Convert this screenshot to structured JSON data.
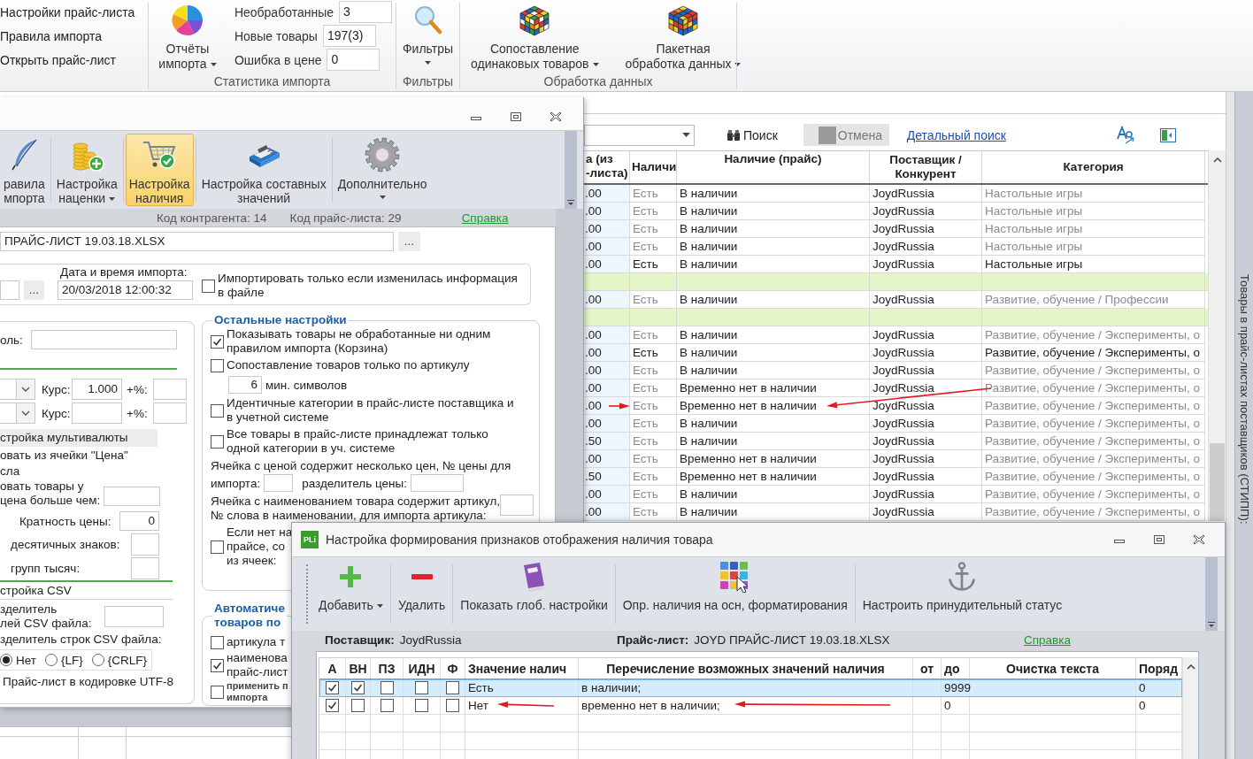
{
  "ribbon": {
    "links": [
      "Настройки прайс-листа",
      "Правила импорта",
      "Открыть прайс-лист"
    ],
    "statistics": {
      "title": "Статистика импорта",
      "reports_button": {
        "lines": [
          "Отчёты",
          "импорта"
        ],
        "dropdown": true
      },
      "counters": [
        {
          "label": "Необработанные",
          "value": "3"
        },
        {
          "label": "Новые товары",
          "value": "197(3)"
        },
        {
          "label": "Ошибка в цене",
          "value": "0"
        }
      ]
    },
    "filters": {
      "title": "Фильтры",
      "button": {
        "lines": [
          "Фильтры"
        ],
        "dropdown": true
      }
    },
    "processing": {
      "title": "Обработка данных",
      "buttons": [
        {
          "lines": [
            "Сопоставление",
            "одинаковых товаров"
          ],
          "dropdown": true
        },
        {
          "lines": [
            "Пакетная",
            "обработка данных"
          ],
          "dropdown": true
        }
      ]
    }
  },
  "settings_window": {
    "toolbar": [
      {
        "lines": [
          "равила",
          "мпорта"
        ],
        "dropdown": false,
        "selected": false
      },
      {
        "lines": [
          "Настройка",
          "наценки"
        ],
        "dropdown": true,
        "selected": false
      },
      {
        "lines": [
          "Настройка",
          "наличия"
        ],
        "dropdown": false,
        "selected": true
      },
      {
        "lines": [
          "Настройка составных",
          "значений"
        ],
        "dropdown": false,
        "selected": false
      },
      {
        "lines": [
          "Дополнительно"
        ],
        "dropdown": true,
        "selected": false
      }
    ],
    "info": {
      "contractor_code": "Код контрагента: 14",
      "pricelist_code": "Код прайс-листа: 29",
      "help_link": "Справка"
    },
    "file_field": {
      "value": "ПРАЙС-ЛИСТ 19.03.18.XLSX",
      "browse_button": "..."
    },
    "import_row": {
      "browse_button": "...",
      "date_label": "Дата и время импорта:",
      "date_value": "20/03/2018 12:00:32",
      "only_if_changed": {
        "label": "Импортировать только если изменилась информация в файле",
        "checked": false
      }
    },
    "general": {
      "password_label": "оль:",
      "currency_rows": [
        {
          "rate_label": "Курс:",
          "rate": "1.000",
          "percent_label": "+%:"
        },
        {
          "rate_label": "Курс:",
          "percent_label": "+%:"
        }
      ],
      "multicurrency_header": "стройка мультивалюты",
      "use_price_cell": [
        "овать из ячейки \"Цена\"",
        "сла"
      ],
      "price_filter": [
        "овать товары у",
        "цена больше чем:"
      ],
      "price_multiple": {
        "label": "Кратность цены:",
        "value": "0"
      },
      "decimal_separator_label": "десятичных знаков:",
      "thousands_separator_label": "групп тысяч:",
      "csv_header": "стройка CSV",
      "csv_field_separator": [
        "зделитель",
        "лей CSV файла:"
      ],
      "csv_row_separator": {
        "label": "зделитель строк CSV файла:",
        "options": [
          {
            "label": "Нет",
            "selected": true
          },
          {
            "label": "{LF}",
            "selected": false
          },
          {
            "label": "{CRLF}",
            "selected": false
          }
        ]
      },
      "utf8_label": "Прайс-лист в кодировке UTF-8"
    },
    "other_settings": {
      "title": "Остальные настройки",
      "items": [
        {
          "kind": "checkbox",
          "label": "Показывать товары не обработанные ни одним правилом импорта (Корзина)",
          "checked": true
        },
        {
          "kind": "checkbox",
          "label": "Сопоставление товаров только по артикулу",
          "checked": false,
          "min_length": {
            "value": "6",
            "label": "мин. символов"
          }
        },
        {
          "kind": "checkbox",
          "label": "Идентичные категории в прайс-листе поставщика и в учетной системе",
          "checked": false
        },
        {
          "kind": "checkbox",
          "label": "Все товары в прайс-листе принадлежат только одной категории в уч. системе",
          "checked": false
        },
        {
          "kind": "price_index",
          "label_lines": [
            "Ячейка с ценой содержит несколько цен, № цены для",
            "импорта:"
          ],
          "separator_label": "разделитель цены:"
        },
        {
          "kind": "article_word",
          "label": "Ячейка с наименованием товара содержит артикул, № слова в наименовании, для импорта артикула:"
        },
        {
          "kind": "checkbox",
          "lines": [
            "Если нет на",
            "прайсе, со",
            "из ячеек:"
          ],
          "checked": false
        }
      ]
    },
    "auto_section": {
      "title": [
        "Автоматиче",
        "товаров по"
      ],
      "items": [
        {
          "kind": "checkbox",
          "lines": [
            "артикула т"
          ],
          "checked": false
        },
        {
          "kind": "checkbox",
          "lines": [
            "наименова",
            "прайс-лист"
          ],
          "checked": true
        },
        {
          "kind": "fine_print",
          "lines": [
            "применить п",
            "импорта"
          ],
          "checked": false
        }
      ]
    }
  },
  "products_window": {
    "search_button": "Поиск",
    "cancel_button": {
      "label": "Отмена",
      "disabled": true
    },
    "advanced_search_link": "Детальный поиск",
    "table": {
      "columns": [
        "а (из -листа)",
        "Наличи",
        "Наличие (прайс)",
        "Поставщик / Конкурент",
        "Категория"
      ],
      "rows": [
        {
          "kind": "item",
          "emphasized": false,
          "cells": [
            ".00",
            "Есть",
            "В наличии",
            "JoydRussia",
            "Настольные игры"
          ]
        },
        {
          "kind": "item",
          "emphasized": false,
          "cells": [
            ".00",
            "Есть",
            "В наличии",
            "JoydRussia",
            "Настольные игры"
          ]
        },
        {
          "kind": "item",
          "emphasized": false,
          "cells": [
            ".00",
            "Есть",
            "В наличии",
            "JoydRussia",
            "Настольные игры"
          ]
        },
        {
          "kind": "item",
          "emphasized": false,
          "cells": [
            ".00",
            "Есть",
            "В наличии",
            "JoydRussia",
            "Настольные игры"
          ]
        },
        {
          "kind": "item",
          "emphasized": true,
          "cells": [
            ".00",
            "Есть",
            "В наличии",
            "JoydRussia",
            "Настольные игры"
          ]
        },
        {
          "kind": "group"
        },
        {
          "kind": "item",
          "emphasized": false,
          "cells": [
            ".00",
            "Есть",
            "В наличии",
            "JoydRussia",
            "Развитие, обучение / Профессии"
          ]
        },
        {
          "kind": "group"
        },
        {
          "kind": "item",
          "emphasized": false,
          "cells": [
            ".00",
            "Есть",
            "В наличии",
            "JoydRussia",
            "Развитие, обучение / Эксперименты, о"
          ]
        },
        {
          "kind": "item",
          "emphasized": true,
          "cells": [
            ".00",
            "Есть",
            "В наличии",
            "JoydRussia",
            "Развитие, обучение / Эксперименты, о"
          ]
        },
        {
          "kind": "item",
          "emphasized": false,
          "cells": [
            ".00",
            "Есть",
            "В наличии",
            "JoydRussia",
            "Развитие, обучение / Эксперименты, о"
          ]
        },
        {
          "kind": "item",
          "emphasized": false,
          "cells": [
            ".00",
            "Есть",
            "Временно нет в наличии",
            "JoydRussia",
            "Развитие, обучение / Эксперименты, о"
          ]
        },
        {
          "kind": "item",
          "emphasized": false,
          "cells": [
            ".00",
            "Есть",
            "Временно нет в наличии",
            "JoydRussia",
            "Развитие, обучение / Эксперименты, о"
          ]
        },
        {
          "kind": "item",
          "emphasized": false,
          "cells": [
            ".00",
            "Есть",
            "В наличии",
            "JoydRussia",
            "Развитие, обучение / Эксперименты, о"
          ]
        },
        {
          "kind": "item",
          "emphasized": false,
          "cells": [
            ".50",
            "Есть",
            "В наличии",
            "JoydRussia",
            "Развитие, обучение / Эксперименты, о"
          ]
        },
        {
          "kind": "item",
          "emphasized": false,
          "cells": [
            ".00",
            "Есть",
            "Временно нет в наличии",
            "JoydRussia",
            "Развитие, обучение / Эксперименты, о"
          ]
        },
        {
          "kind": "item",
          "emphasized": false,
          "cells": [
            ".50",
            "Есть",
            "Временно нет в наличии",
            "JoydRussia",
            "Развитие, обучение / Эксперименты, о"
          ]
        },
        {
          "kind": "item",
          "emphasized": false,
          "cells": [
            ".00",
            "Есть",
            "В наличии",
            "JoydRussia",
            "Развитие, обучение / Эксперименты, о"
          ]
        },
        {
          "kind": "item",
          "emphasized": false,
          "cells": [
            ".00",
            "Есть",
            "В наличии",
            "JoydRussia",
            "Развитие, обучение / Эксперименты, о"
          ]
        }
      ]
    },
    "side_tab": "Товары в прайс-листах поставщиков (СТИПП):"
  },
  "availability_window": {
    "logo": "PLi",
    "title": "Настройка формирования признаков отображения наличия товара",
    "toolbar": [
      {
        "lines": [
          "Добавить"
        ],
        "dropdown": true
      },
      {
        "lines": [
          "Удалить"
        ],
        "dropdown": false
      },
      {
        "lines": [
          "Показать глоб. настройки"
        ],
        "dropdown": false
      },
      {
        "lines": [
          "Опр. наличия на осн, форматирования"
        ],
        "dropdown": false
      },
      {
        "lines": [
          "Настроить принудительный статус"
        ],
        "dropdown": false
      }
    ],
    "info": {
      "supplier_label": "Поставщик:",
      "supplier": "JoydRussia",
      "pricelist_label": "Прайс-лист:",
      "pricelist": "JOYD ПРАЙС-ЛИСТ 19.03.18.XLSX",
      "help_link": "Справка"
    },
    "table": {
      "columns": [
        "А",
        "ВН",
        "ПЗ",
        "ИДН",
        "Ф",
        "Значение налич",
        "Перечисление возможных значений наличия",
        "от",
        "до",
        "Очистка текста",
        "Поряд"
      ],
      "rows": [
        {
          "selected": true,
          "flags": [
            {
              "checked": true
            },
            {
              "checked": true
            },
            {
              "checked": false
            },
            {
              "checked": false
            },
            {
              "checked": false
            }
          ],
          "value": "Есть",
          "variants": "в наличии;",
          "to": "9999",
          "order": "0"
        },
        {
          "selected": false,
          "flags": [
            {
              "checked": true
            },
            {
              "checked": false
            },
            {
              "checked": false
            },
            {
              "checked": false
            },
            {
              "checked": false
            }
          ],
          "value": "Нет",
          "variants": "временно нет в наличии;",
          "to": "0",
          "order": "0"
        }
      ]
    }
  }
}
